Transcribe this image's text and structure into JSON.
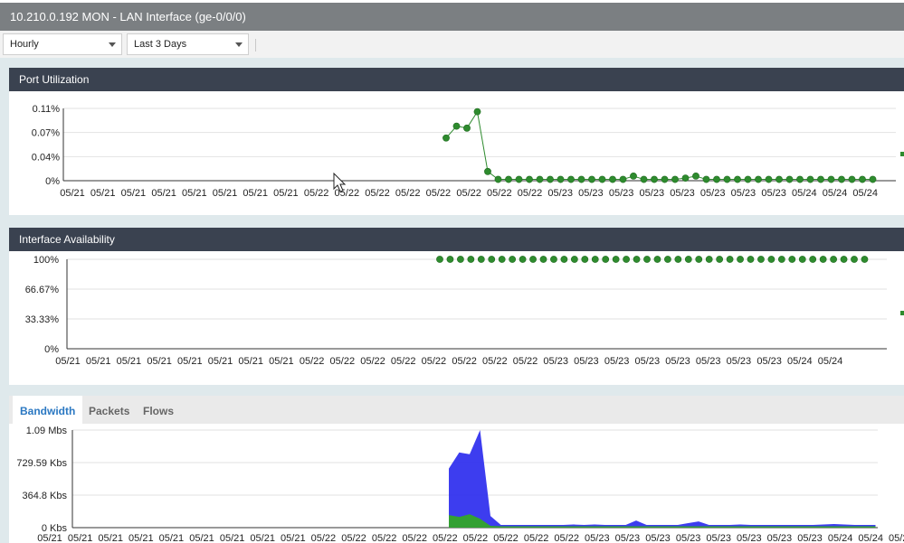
{
  "window": {
    "title": "10.210.0.192 MON - LAN Interface (ge-0/0/0)"
  },
  "toolbar": {
    "interval": "Hourly",
    "range": "Last 3 Days"
  },
  "panels": {
    "port_utilization": "Port Utilization",
    "interface_availability": "Interface Availability"
  },
  "tabs": [
    {
      "label": "Bandwidth",
      "active": true
    },
    {
      "label": "Packets",
      "active": false
    },
    {
      "label": "Flows",
      "active": false
    }
  ],
  "colors": {
    "series": "#2e8b2e",
    "bandwidth_in": "#3333ee",
    "bandwidth_out": "#33a033",
    "header": "#3a4250"
  },
  "chart_data": [
    {
      "type": "line",
      "ylim": [
        0,
        0.11
      ],
      "yticks": [
        "0.11%",
        "0.07%",
        "0.04%",
        "0%"
      ],
      "xticks": [
        "05/21",
        "05/21",
        "05/21",
        "05/21",
        "05/21",
        "05/21",
        "05/21",
        "05/21",
        "05/22",
        "05/22",
        "05/22",
        "05/22",
        "05/22",
        "05/22",
        "05/22",
        "05/22",
        "05/23",
        "05/23",
        "05/23",
        "05/23",
        "05/23",
        "05/23",
        "05/23",
        "05/23",
        "05/24",
        "05/24",
        "05/24"
      ],
      "x_index": [
        34,
        35,
        36,
        37,
        38,
        39,
        40,
        41,
        42,
        43,
        44,
        45,
        46,
        47,
        48,
        49,
        50,
        51,
        52,
        53,
        54,
        55,
        56,
        57,
        58,
        59,
        60,
        61,
        62,
        63,
        64,
        65,
        66,
        67,
        68,
        69,
        70,
        71,
        72,
        73,
        74,
        75
      ],
      "values": [
        0.065,
        0.083,
        0.08,
        0.105,
        0.014,
        0.002,
        0.002,
        0.002,
        0.002,
        0.002,
        0.002,
        0.002,
        0.002,
        0.002,
        0.002,
        0.002,
        0.002,
        0.002,
        0.007,
        0.002,
        0.002,
        0.002,
        0.002,
        0.004,
        0.007,
        0.002,
        0.002,
        0.002,
        0.002,
        0.002,
        0.002,
        0.002,
        0.002,
        0.002,
        0.002,
        0.002,
        0.002,
        0.002,
        0.002,
        0.002,
        0.002,
        0.002
      ]
    },
    {
      "type": "scatter",
      "ylim": [
        0,
        100
      ],
      "yticks": [
        "100%",
        "66.67%",
        "33.33%",
        "0%"
      ],
      "xticks": [
        "05/21",
        "05/21",
        "05/21",
        "05/21",
        "05/21",
        "05/21",
        "05/21",
        "05/21",
        "05/22",
        "05/22",
        "05/22",
        "05/22",
        "05/22",
        "05/22",
        "05/22",
        "05/22",
        "05/23",
        "05/23",
        "05/23",
        "05/23",
        "05/23",
        "05/23",
        "05/23",
        "05/23",
        "05/24",
        "05/24"
      ],
      "x_index": [
        34,
        35,
        36,
        37,
        38,
        39,
        40,
        41,
        42,
        43,
        44,
        45,
        46,
        47,
        48,
        49,
        50,
        51,
        52,
        53,
        54,
        55,
        56,
        57,
        58,
        59,
        60,
        61,
        62,
        63,
        64,
        65,
        66,
        67,
        68,
        69,
        70,
        71,
        72,
        73,
        74,
        75
      ],
      "values": [
        100,
        100,
        100,
        100,
        100,
        100,
        100,
        100,
        100,
        100,
        100,
        100,
        100,
        100,
        100,
        100,
        100,
        100,
        100,
        100,
        100,
        100,
        100,
        100,
        100,
        100,
        100,
        100,
        100,
        100,
        100,
        100,
        100,
        100,
        100,
        100,
        100,
        100,
        100,
        100,
        100,
        100
      ]
    },
    {
      "type": "area",
      "ylim": [
        0,
        1.09
      ],
      "yticks": [
        "1.09 Mbs",
        "729.59 Kbs",
        "364.8 Kbs",
        "0 Kbs"
      ],
      "xticks": [
        "05/21",
        "05/21",
        "05/21",
        "05/21",
        "05/21",
        "05/21",
        "05/21",
        "05/21",
        "05/21",
        "05/22",
        "05/22",
        "05/22",
        "05/22",
        "05/22",
        "05/22",
        "05/22",
        "05/22",
        "05/22",
        "05/23",
        "05/23",
        "05/23",
        "05/23",
        "05/23",
        "05/23",
        "05/23",
        "05/23",
        "05/24",
        "05/24",
        "05/24"
      ],
      "x_index": [
        34,
        35,
        36,
        37,
        38,
        39,
        40,
        41,
        42,
        43,
        44,
        45,
        46,
        47,
        48,
        49,
        50,
        51,
        52,
        53,
        54,
        55,
        56,
        57,
        58,
        59,
        60,
        61,
        62,
        63,
        64,
        65,
        66,
        67,
        68,
        69,
        70,
        71,
        72,
        73,
        74,
        75
      ],
      "series": [
        {
          "values": [
            0.14,
            0.12,
            0.15,
            0.1,
            0.02,
            0.015,
            0.015,
            0.015,
            0.015,
            0.015,
            0.015,
            0.015,
            0.015,
            0.015,
            0.015,
            0.015,
            0.015,
            0.015,
            0.015,
            0.015,
            0.015,
            0.015,
            0.015,
            0.015,
            0.015,
            0.015,
            0.015,
            0.015,
            0.015,
            0.015,
            0.015,
            0.015,
            0.015,
            0.015,
            0.015,
            0.015,
            0.015,
            0.015,
            0.015,
            0.015,
            0.015,
            0.015
          ]
        },
        {
          "values": [
            0.66,
            0.84,
            0.82,
            1.09,
            0.13,
            0.03,
            0.03,
            0.03,
            0.03,
            0.03,
            0.03,
            0.03,
            0.035,
            0.03,
            0.035,
            0.03,
            0.03,
            0.03,
            0.08,
            0.03,
            0.03,
            0.03,
            0.03,
            0.05,
            0.07,
            0.03,
            0.03,
            0.03,
            0.035,
            0.03,
            0.03,
            0.03,
            0.03,
            0.03,
            0.03,
            0.03,
            0.035,
            0.04,
            0.035,
            0.03,
            0.03,
            0.03
          ]
        }
      ]
    }
  ]
}
